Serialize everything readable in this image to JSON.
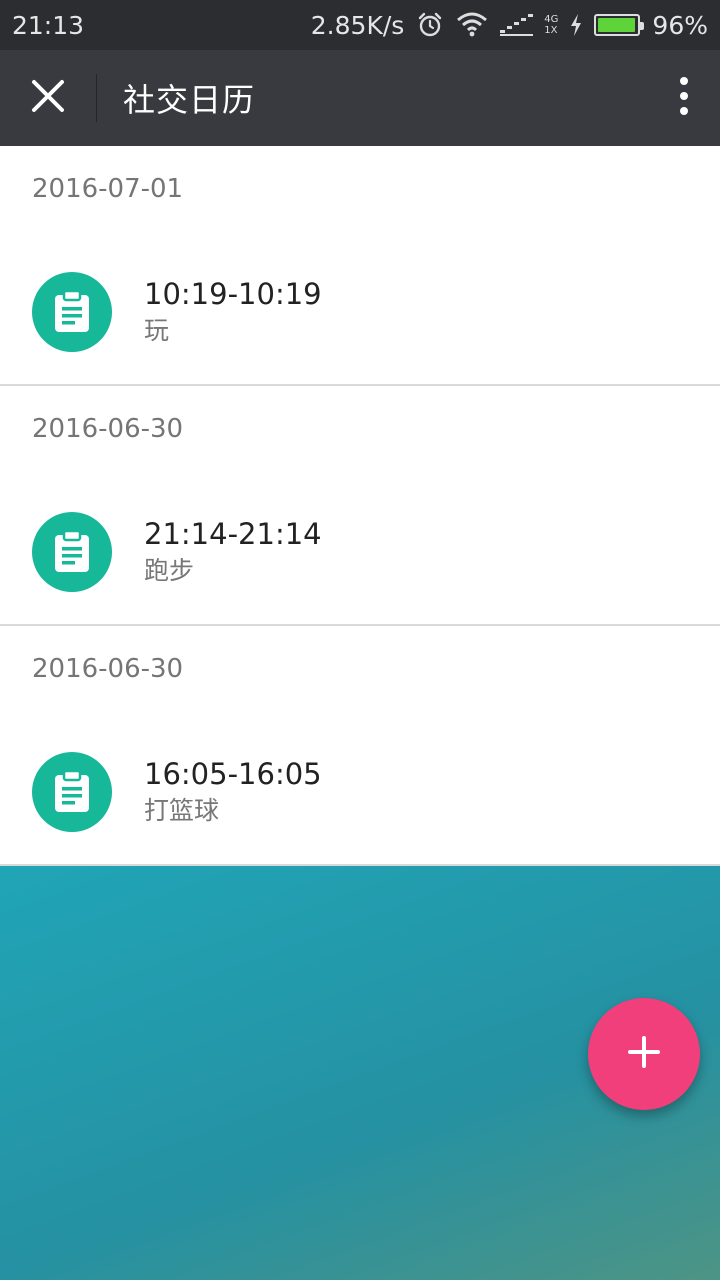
{
  "status_bar": {
    "time": "21:13",
    "net_speed": "2.85K/s",
    "net_type_top": "4G",
    "net_type_bottom": "1X",
    "battery_percent": "96%",
    "battery_level": 0.96,
    "battery_color": "#5fd43a"
  },
  "app_bar": {
    "title": "社交日历",
    "close_icon": "close-icon",
    "more_icon": "more-vertical-icon"
  },
  "entries": [
    {
      "date": "2016-07-01",
      "time_range": "10:19-10:19",
      "activity": "玩",
      "icon": "clipboard-icon"
    },
    {
      "date": "2016-06-30",
      "time_range": "21:14-21:14",
      "activity": "跑步",
      "icon": "clipboard-icon"
    },
    {
      "date": "2016-06-30",
      "time_range": "16:05-16:05",
      "activity": "打篮球",
      "icon": "clipboard-icon"
    }
  ],
  "colors": {
    "status_bar_bg": "#2c2d31",
    "app_bar_bg": "#393a3f",
    "avatar_bg": "#17b79a",
    "fab_bg": "#f03f7b"
  },
  "fab": {
    "icon": "plus-icon"
  }
}
